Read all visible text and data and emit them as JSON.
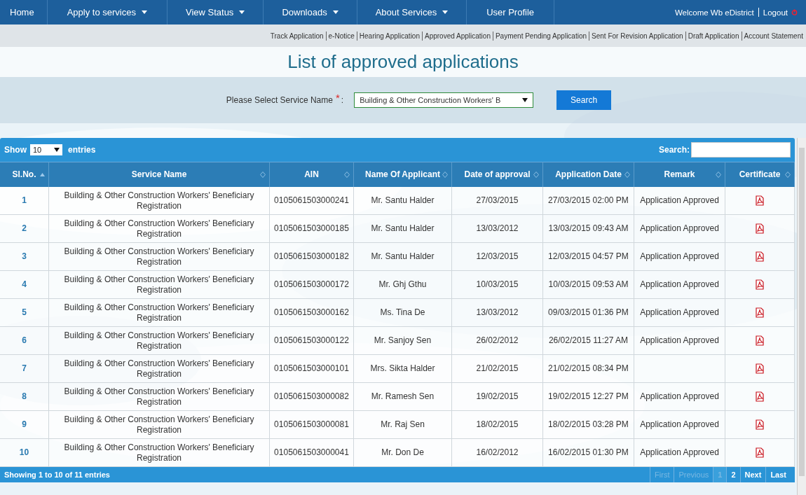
{
  "nav": {
    "items": [
      {
        "label": "Home",
        "dropdown": false
      },
      {
        "label": "Apply to services",
        "dropdown": true
      },
      {
        "label": "View Status",
        "dropdown": true
      },
      {
        "label": "Downloads",
        "dropdown": true
      },
      {
        "label": "About Services",
        "dropdown": true
      },
      {
        "label": "User Profile",
        "dropdown": false
      }
    ],
    "welcome": "Welcome Wb eDistrict",
    "logout": "Logout"
  },
  "subnav": [
    "Track Application",
    "e-Notice",
    "Hearing Application",
    "Approved Application",
    "Payment Pending Application",
    "Sent For Revision Application",
    "Draft Application",
    "Account Statement"
  ],
  "title": "List of approved applications",
  "filter": {
    "label": "Please Select Service Name",
    "required": "*",
    "colon": ":",
    "value": "Building & Other Construction Workers' B",
    "button": "Search"
  },
  "table": {
    "show_label": "Show",
    "page_size": "10",
    "entries_label": "entries",
    "search_label": "Search:",
    "columns": [
      {
        "label": "Sl.No.",
        "sorted": true
      },
      {
        "label": "Service Name",
        "sorted": false
      },
      {
        "label": "AIN",
        "sorted": false
      },
      {
        "label": "Name Of Applicant",
        "sorted": false
      },
      {
        "label": "Date of approval",
        "sorted": false
      },
      {
        "label": "Application Date",
        "sorted": false
      },
      {
        "label": "Remark",
        "sorted": false
      },
      {
        "label": "Certificate",
        "sorted": false
      }
    ],
    "rows": [
      {
        "no": "1",
        "service": "Building & Other Construction Workers' Beneficiary Registration",
        "ain": "0105061503000241",
        "name": "Mr. Santu Halder",
        "approved": "27/03/2015",
        "applied": "27/03/2015 02:00 PM",
        "remark": "Application Approved"
      },
      {
        "no": "2",
        "service": "Building & Other Construction Workers' Beneficiary Registration",
        "ain": "0105061503000185",
        "name": "Mr. Santu Halder",
        "approved": "13/03/2012",
        "applied": "13/03/2015 09:43 AM",
        "remark": "Application Approved"
      },
      {
        "no": "3",
        "service": "Building & Other Construction Workers' Beneficiary Registration",
        "ain": "0105061503000182",
        "name": "Mr. Santu Halder",
        "approved": "12/03/2015",
        "applied": "12/03/2015 04:57 PM",
        "remark": "Application Approved"
      },
      {
        "no": "4",
        "service": "Building & Other Construction Workers' Beneficiary Registration",
        "ain": "0105061503000172",
        "name": "Mr. Ghj Gthu",
        "approved": "10/03/2015",
        "applied": "10/03/2015 09:53 AM",
        "remark": "Application Approved"
      },
      {
        "no": "5",
        "service": "Building & Other Construction Workers' Beneficiary Registration",
        "ain": "0105061503000162",
        "name": "Ms. Tina De",
        "approved": "13/03/2012",
        "applied": "09/03/2015 01:36 PM",
        "remark": "Application Approved"
      },
      {
        "no": "6",
        "service": "Building & Other Construction Workers' Beneficiary Registration",
        "ain": "0105061503000122",
        "name": "Mr. Sanjoy Sen",
        "approved": "26/02/2012",
        "applied": "26/02/2015 11:27 AM",
        "remark": "Application Approved"
      },
      {
        "no": "7",
        "service": "Building & Other Construction Workers' Beneficiary Registration",
        "ain": "0105061503000101",
        "name": "Mrs. Sikta Halder",
        "approved": "21/02/2015",
        "applied": "21/02/2015 08:34 PM"
      },
      {
        "no": "8",
        "service": "Building & Other Construction Workers' Beneficiary Registration",
        "ain": "0105061503000082",
        "name": "Mr. Ramesh Sen",
        "approved": "19/02/2015",
        "applied": "19/02/2015 12:27 PM",
        "remark": "Application Approved"
      },
      {
        "no": "9",
        "service": "Building & Other Construction Workers' Beneficiary Registration",
        "ain": "0105061503000081",
        "name": "Mr. Raj Sen",
        "approved": "18/02/2015",
        "applied": "18/02/2015 03:28 PM",
        "remark": "Application Approved"
      },
      {
        "no": "10",
        "service": "Building & Other Construction Workers' Beneficiary Registration",
        "ain": "0105061503000041",
        "name": "Mr. Don De",
        "approved": "16/02/2012",
        "applied": "16/02/2015 01:30 PM",
        "remark": "Application Approved"
      }
    ],
    "info": "Showing 1 to 10 of 11 entries",
    "pages": [
      {
        "label": "First",
        "disabled": true,
        "selected": false
      },
      {
        "label": "Previous",
        "disabled": true,
        "selected": false
      },
      {
        "label": "1",
        "disabled": false,
        "selected": true
      },
      {
        "label": "2",
        "disabled": false,
        "selected": false
      },
      {
        "label": "Next",
        "disabled": false,
        "selected": false
      },
      {
        "label": "Last",
        "disabled": false,
        "selected": false
      }
    ]
  }
}
